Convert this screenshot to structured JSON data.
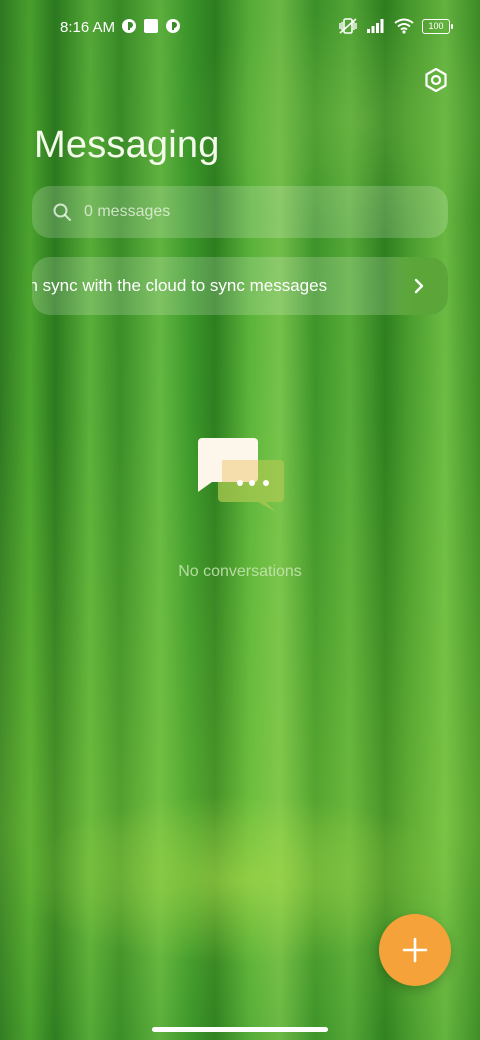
{
  "status_bar": {
    "time": "8:16 AM",
    "battery": "100",
    "icons": [
      "app-notification-icon",
      "stop-square-icon",
      "app-notification-icon",
      "vibrate-off-icon",
      "signal-icon",
      "wifi-icon",
      "battery-icon"
    ]
  },
  "header": {
    "title": "Messaging",
    "settings_icon": "settings-icon"
  },
  "search": {
    "placeholder": "0 messages"
  },
  "sync_banner": {
    "text": "Turn on sync with the cloud to sync messages"
  },
  "empty_state": {
    "text": "No conversations"
  },
  "fab": {
    "icon": "plus-icon",
    "color": "#f6a23a"
  },
  "colors": {
    "accent": "#f6a23a"
  }
}
